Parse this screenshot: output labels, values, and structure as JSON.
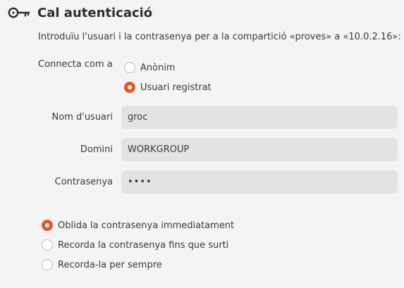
{
  "dialog": {
    "title": "Cal autenticació",
    "message": "Introduïu l'usuari i la contrasenya per a la compartició «proves» a «10.0.2.16»:"
  },
  "connect": {
    "label": "Connecta com a",
    "options": [
      {
        "label": "Anònim",
        "checked": false
      },
      {
        "label": "Usuari registrat",
        "checked": true
      }
    ]
  },
  "fields": {
    "username": {
      "label": "Nom d'usuari",
      "value": "groc"
    },
    "domain": {
      "label": "Domini",
      "value": "WORKGROUP"
    },
    "password": {
      "label": "Contrasenya",
      "value": "••••"
    }
  },
  "remember": {
    "options": [
      {
        "label": "Oblida la contrasenya immediatament",
        "checked": true
      },
      {
        "label": "Recorda la contrasenya fins que surti",
        "checked": false
      },
      {
        "label": "Recorda-la per sempre",
        "checked": false
      }
    ]
  },
  "colors": {
    "accent": "#e95420",
    "background": "#f4f4f4",
    "entry_background": "#e3e3e3"
  },
  "icons": {
    "title_icon": "key-icon"
  }
}
